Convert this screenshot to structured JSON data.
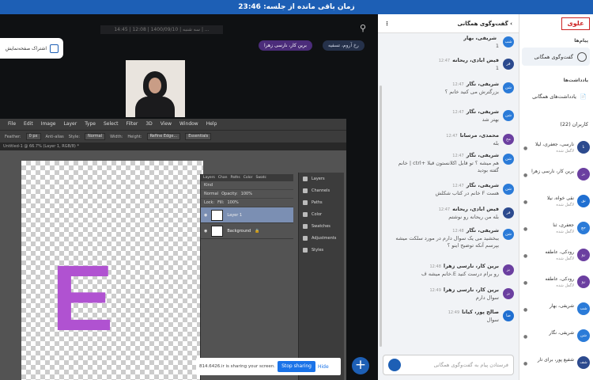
{
  "topbar": {
    "text": "زمان باقی مانده از جلسه: 23:46"
  },
  "stage": {
    "clock": "14:45 | 12:08 | 1400/09/10 | سه شنبه | ...",
    "share_label": "اشتراک صفحه‌نمایش",
    "pill_speaker": "برین کار، نارسی زهرا",
    "pill_other": "رخ آروم، تسفیه"
  },
  "photoshop": {
    "menu": [
      "File",
      "Edit",
      "Image",
      "Layer",
      "Type",
      "Select",
      "Filter",
      "3D",
      "View",
      "Window",
      "Help"
    ],
    "feather": "Feather:",
    "feather_val": "0 px",
    "anti_alias": "Anti-alias",
    "style": "Style:",
    "style_val": "Normal",
    "width": "Width:",
    "height": "Height:",
    "refine": "Refine Edge...",
    "workspace": "Essentials",
    "doc_tab": "Untitled-1 @ 66.7% (Layer 1, RGB/8) *",
    "panel_tabs": [
      "Layers",
      "Chan",
      "Paths",
      "Color",
      "Swatc"
    ],
    "kind": "Kind",
    "blend": "Normal",
    "opacity": "Opacity:",
    "opacity_val": "100%",
    "lock": "Lock:",
    "fill": "Fill:",
    "fill_val": "100%",
    "layer1": "Layer 1",
    "background": "Background",
    "dock": [
      "Layers",
      "Channels",
      "Paths",
      "Color",
      "Swatches",
      "Adjustments",
      "Styles"
    ],
    "letter": "E"
  },
  "screen_share": {
    "text": "814.6426.ir is sharing your screen.",
    "stop": "Stop sharing",
    "hide": "Hide"
  },
  "chat": {
    "title": "گفت‌وگوی همگانی",
    "input_placeholder": "فرستادن پیام به گفت‌وگوی همگانی",
    "messages": [
      {
        "name": "شریفی، بهار",
        "time": "",
        "text": "1",
        "abbr": "شب",
        "color": "#2b7bd8"
      },
      {
        "name": "فیض ابادی، ریحانه",
        "time": "12:47",
        "text": "1",
        "abbr": "فر",
        "color": "#2c4a8e"
      },
      {
        "name": "شریفی، نگار",
        "time": "12:47",
        "text": "بزرگترش می کنید خانم ؟",
        "abbr": "شن",
        "color": "#2b7bd8"
      },
      {
        "name": "شریفی، نگار",
        "time": "12:47",
        "text": "بهتر شد",
        "abbr": "شن",
        "color": "#2b7bd8"
      },
      {
        "name": "محمدی، مرسانا",
        "time": "12:47",
        "text": "بله",
        "abbr": "مح",
        "color": "#6b3fa0"
      },
      {
        "name": "شریفی، نگار",
        "time": "12:47",
        "text": "خانم | ctrl+ هم میشه ؟ تو قابل اکلانستون قبلا گفته بودید",
        "abbr": "شن",
        "color": "#2b7bd8"
      },
      {
        "name": "شریفی، نگار",
        "time": "12:47",
        "text": "خانم در کتاب شکلش F هست",
        "abbr": "شن",
        "color": "#2b7bd8"
      },
      {
        "name": "فیض ابادی، ریحانه",
        "time": "12:47",
        "text": "بله من ریحانه رو نوشتم",
        "abbr": "فر",
        "color": "#2c4a8e"
      },
      {
        "name": "شریفی، نگار",
        "time": "12:48",
        "text": "ببخشید می یک سوال دارم در مورد سلکت میشه بپرسم آنکه توضیح اینو ؟",
        "abbr": "شن",
        "color": "#2b7bd8"
      },
      {
        "name": "برین کار، نارسی زهرا",
        "time": "12:48",
        "text": "خانم میشه ف.E رو برام درست کنید",
        "abbr": "بز",
        "color": "#6b3fa0"
      },
      {
        "name": "برین کار، نارسی زهرا",
        "time": "12:49",
        "text": "سوال دارم",
        "abbr": "بز",
        "color": "#6b3fa0"
      },
      {
        "name": "صالح پور، کیانا",
        "time": "12:49",
        "text": "سوال",
        "abbr": "صا",
        "color": "#1f6fd1"
      }
    ]
  },
  "sidebar": {
    "logo": "علوی",
    "messages_hd": "پیام‌ها",
    "public_chat": "گفت‌وگوی همگانی",
    "notes_hd": "یادداشت‌ها",
    "shared_notes": "یادداشت‌های همگانی",
    "users_hd": "کاربران (22)",
    "users": [
      {
        "name": "نارسی، جعفری، لیلا",
        "st": "لاگفل شده",
        "abbr": "نا",
        "color": "#2c4a8e"
      },
      {
        "name": "برین کار، نارسی زهرا",
        "st": "",
        "abbr": "بز",
        "color": "#6b3fa0"
      },
      {
        "name": "نقی خواه، نیلا",
        "st": "لاگفل شده",
        "abbr": "نق",
        "color": "#1f6fd1"
      },
      {
        "name": "جعفری، ثنا",
        "st": "لاگفل شده",
        "abbr": "جع",
        "color": "#2b7bd8"
      },
      {
        "name": "رودکی، عاطفه",
        "st": "لاگفل شده",
        "abbr": "رو",
        "color": "#6b3fa0"
      },
      {
        "name": "رودکی، عاطفه",
        "st": "لاگفل شده",
        "abbr": "رو",
        "color": "#6b3fa0"
      },
      {
        "name": "شریفی، بهار",
        "st": "",
        "abbr": "شب",
        "color": "#2b7bd8"
      },
      {
        "name": "شریفی، نگار",
        "st": "",
        "abbr": "شن",
        "color": "#2b7bd8"
      },
      {
        "name": "شفیع پور، برای تار",
        "st": "",
        "abbr": "شف",
        "color": "#2c4a8e"
      }
    ]
  }
}
